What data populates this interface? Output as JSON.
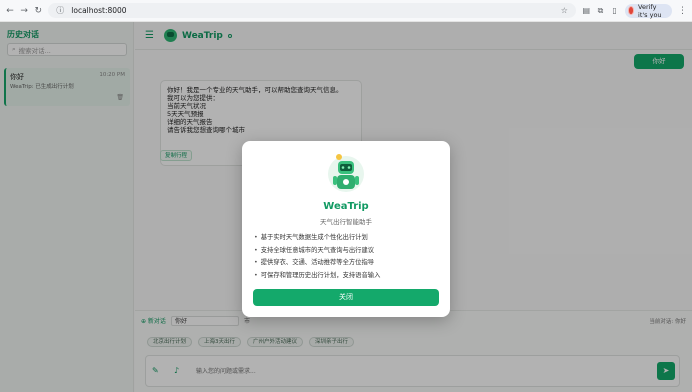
{
  "browser": {
    "url": "localhost:8000",
    "profile_label": "Verify it's you"
  },
  "sidebar": {
    "title": "历史对话",
    "search_placeholder": "搜索对话...",
    "items": [
      {
        "title": "你好",
        "time": "10:20 PM",
        "subtitle": "WeaTrip: 已生成出行计划",
        "delete_icon": "trash-icon"
      }
    ]
  },
  "header": {
    "brand": "WeaTrip",
    "menu_icon": "hamburger-icon"
  },
  "chat": {
    "user_message": "你好",
    "bot_lines": [
      "你好！我是一个专业的天气助手，可以帮助您查询天气信息。",
      "我可以为您提供：",
      "当前天气状况",
      "5天天气预报",
      "详细的天气报告",
      "请告诉我您想查询哪个城市"
    ],
    "copy_label": "复制行程"
  },
  "bottom": {
    "new_chat_label": "⊕ 新对话",
    "city_value": "你好",
    "city_label": "市",
    "right_label": "当前对话: 你好",
    "chips": [
      "北京出行计划",
      "上海3天出行",
      "广州户外活动建议",
      "深圳亲子出行"
    ],
    "input_placeholder": "输入您的问题或需求...",
    "colors": {
      "accent": "#14a96b"
    }
  },
  "modal": {
    "title": "WeaTrip",
    "subtitle": "天气出行智能助手",
    "features": [
      "基于实时天气数据生成个性化出行计划",
      "支持全球任意城市的天气查询与出行建议",
      "提供穿衣、交通、活动推荐等全方位指导",
      "可保存和管理历史出行计划，支持语音输入"
    ],
    "close_label": "关闭"
  }
}
